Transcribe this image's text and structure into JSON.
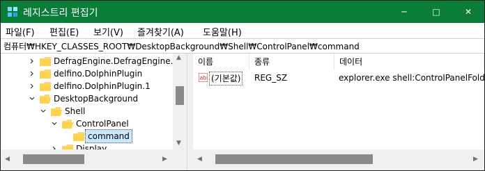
{
  "window": {
    "title": "레지스트리 편집기",
    "accent_color": "#0a7d38"
  },
  "window_controls": {
    "minimize": "─",
    "maximize": "□",
    "close": "✕"
  },
  "menu": {
    "items": [
      "파일(F)",
      "편집(E)",
      "보기(V)",
      "즐겨찾기(A)",
      "도움말(H)"
    ]
  },
  "address": {
    "path": "컴퓨터₩HKEY_CLASSES_ROOT₩DesktopBackground₩Shell₩ControlPanel₩command"
  },
  "tree": {
    "items": [
      {
        "label": "DefragEngine.DefragEngine.1",
        "expanded": false
      },
      {
        "label": "delfino.DolphinPlugin",
        "expanded": false
      },
      {
        "label": "delfino.DolphinPlugin.1",
        "expanded": false
      },
      {
        "label": "DesktopBackground",
        "expanded": true
      },
      {
        "label": "Shell",
        "expanded": true
      },
      {
        "label": "ControlPanel",
        "expanded": true
      },
      {
        "label": "command",
        "selected": true
      },
      {
        "label": "Display",
        "expanded": false
      }
    ]
  },
  "list": {
    "columns": [
      "이름",
      "종류",
      "데이터"
    ],
    "rows": [
      {
        "name": "(기본값)",
        "type": "REG_SZ",
        "data": "explorer.exe shell:ControlPanelFolder",
        "icon": "string-value-icon"
      }
    ]
  },
  "scroll": {
    "left": "◀",
    "right": "▶",
    "up": "▲",
    "down": "▼"
  }
}
